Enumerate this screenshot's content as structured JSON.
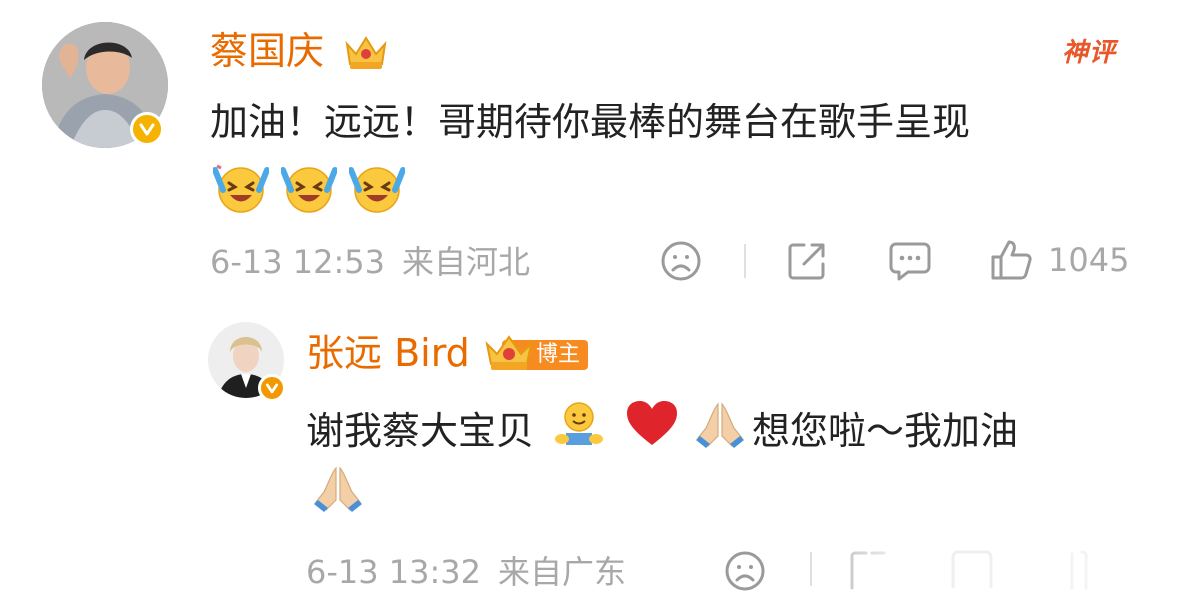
{
  "comment": {
    "author": "蔡国庆",
    "badge_icon": "crown-icon",
    "tag": "神评",
    "text": "加油！远远！哥期待你最棒的舞台在歌手呈现",
    "emojis": [
      "laughing-tears-emoji",
      "laughing-tears-emoji",
      "laughing-tears-emoji"
    ],
    "date": "6-13 12:53",
    "location": "来自河北",
    "like_count": "1045",
    "icons": [
      "dislike-icon",
      "share-icon",
      "comment-icon",
      "like-icon"
    ]
  },
  "reply": {
    "author": "张远 Bird",
    "role_badge": "博主",
    "text_before": "谢我蔡大宝贝",
    "text_after": "想您啦～我加油",
    "emojis": [
      "hug-emoji",
      "heart-emoji",
      "pray-emoji",
      "pray-emoji"
    ],
    "date": "6-13 13:32",
    "location": "来自广东"
  },
  "colors": {
    "name": "#e96b00",
    "meta": "#a8a8a8",
    "verify": "#f5b300",
    "blogger_badge": "#f78b1f",
    "shenping": "#e8572a"
  }
}
